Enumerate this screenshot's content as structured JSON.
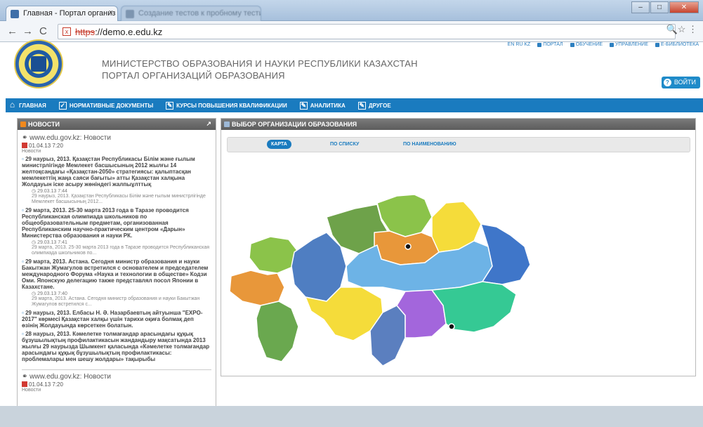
{
  "browser": {
    "tab_active": "Главная - Портал организ",
    "tab_inactive": "Создание тестов к пробному тестированию - Microsoft Word",
    "url_proto": "https",
    "url_rest": "://demo.e.edu.kz",
    "tab_close": "×",
    "min": "–",
    "max": "□",
    "close": "✕"
  },
  "header": {
    "title1": "МИНИСТЕРСТВО ОБРАЗОВАНИЯ И НАУКИ РЕСПУБЛИКИ КАЗАХСТАН",
    "title2": "ПОРТАЛ ОРГАНИЗАЦИЙ ОБРАЗОВАНИЯ",
    "lang": "EN RU KZ",
    "links": [
      "ПОРТАЛ",
      "ОБУЧЕНИЕ",
      "УПРАВЛЕНИЕ",
      "Е-БИБЛИОТЕКА"
    ],
    "login": "ВОЙТИ"
  },
  "nav": [
    "ГЛАВНАЯ",
    "НОРМАТИВНЫЕ ДОКУМЕНТЫ",
    "КУРСЫ ПОВЫШЕНИЯ КВАЛИФИКАЦИИ",
    "АНАЛИТИКА",
    "ДРУГОЕ"
  ],
  "news": {
    "title": "НОВОСТИ",
    "feed1": "www.edu.gov.kz: Новости",
    "date1": "01.04.13 7:20",
    "category": "Новости",
    "items": [
      {
        "title": "29 наурыз, 2013. Қазақстан Республикасы Білім және ғылым министрлігінде Мемлекет басшысының 2012 жылғы 14 желтоқсандағы «Қазақстан-2050» стратегиясы: қалыптасқан мемлекеттің жаңа саяси бағыты» атты Қазақстан халқына Жолдауын іске асыру жөніндегі жалпыұлттық",
        "stamp": "29.03.13 7:44",
        "desc": "29 наурыз, 2013. Қазақстан Республикасы Білім және ғылым министрлігінде Мемлекет басшысының 2012..."
      },
      {
        "title": "29 марта, 2013. 25-30 марта 2013 года в Таразе проводится Республиканская олимпиада школьников по общеобразовательным предметам, организованная Республиканским научно-практическим центром «Дарын» Министерства образования и науки РК.",
        "stamp": "29.03.13 7:41",
        "desc": "29 марта, 2013. 25-30 марта 2013 года в Таразе проводится Республиканская олимпиада школьников по..."
      },
      {
        "title": "29 марта, 2013. Астана. Сегодня министр образования и науки Бакытжан Жумагулов встретился с основателем и председателем международного Форума «Наука и технологии в обществе» Кодзи Оми. Японскую делегацию также представлял посол Японии в Казахстане.",
        "stamp": "29.03.13 7:40",
        "desc": "29 марта, 2013. Астана. Сегодня министр образования и науки Бакытжан Жумагулов встретился с..."
      },
      {
        "title": "29 наурыз, 2013. Елбасы Н. Ә. Назарбаевтың айтуынша \"EXPO-2017\" көрмесі Қазақстан халқы үшін тарихи оқиға болмақ деп өзінің Жолдауында көрсеткен болатын.",
        "stamp": "",
        "desc": ""
      },
      {
        "title": "28 наурыз, 2013. Кәмелетке толмағандар арасындағы құқық бұзушылықтың профилактикасын жандандыру мақсатында 2013 жылғы 29 наурызда Шымкент қаласында «Кәмелетке толмағандар арасындағы құқық бұзушылықтың профилактикасы: проблемалары мен шешу жолдары» тақырыбы",
        "stamp": "",
        "desc": ""
      }
    ],
    "feed2": "www.edu.gov.kz: Новости",
    "date2": "01.04.13 7:20",
    "category2": "Новости"
  },
  "map": {
    "title": "ВЫБОР ОРГАНИЗАЦИИ ОБРАЗОВАНИЯ",
    "tabs": [
      "КАРТА",
      "ПО СПИСКУ",
      "ПО НАИМЕНОВАНИЮ"
    ]
  },
  "colors": {
    "nav": "#1a7bbf",
    "accent": "#2d7fc0",
    "rss": "#f2891c"
  }
}
